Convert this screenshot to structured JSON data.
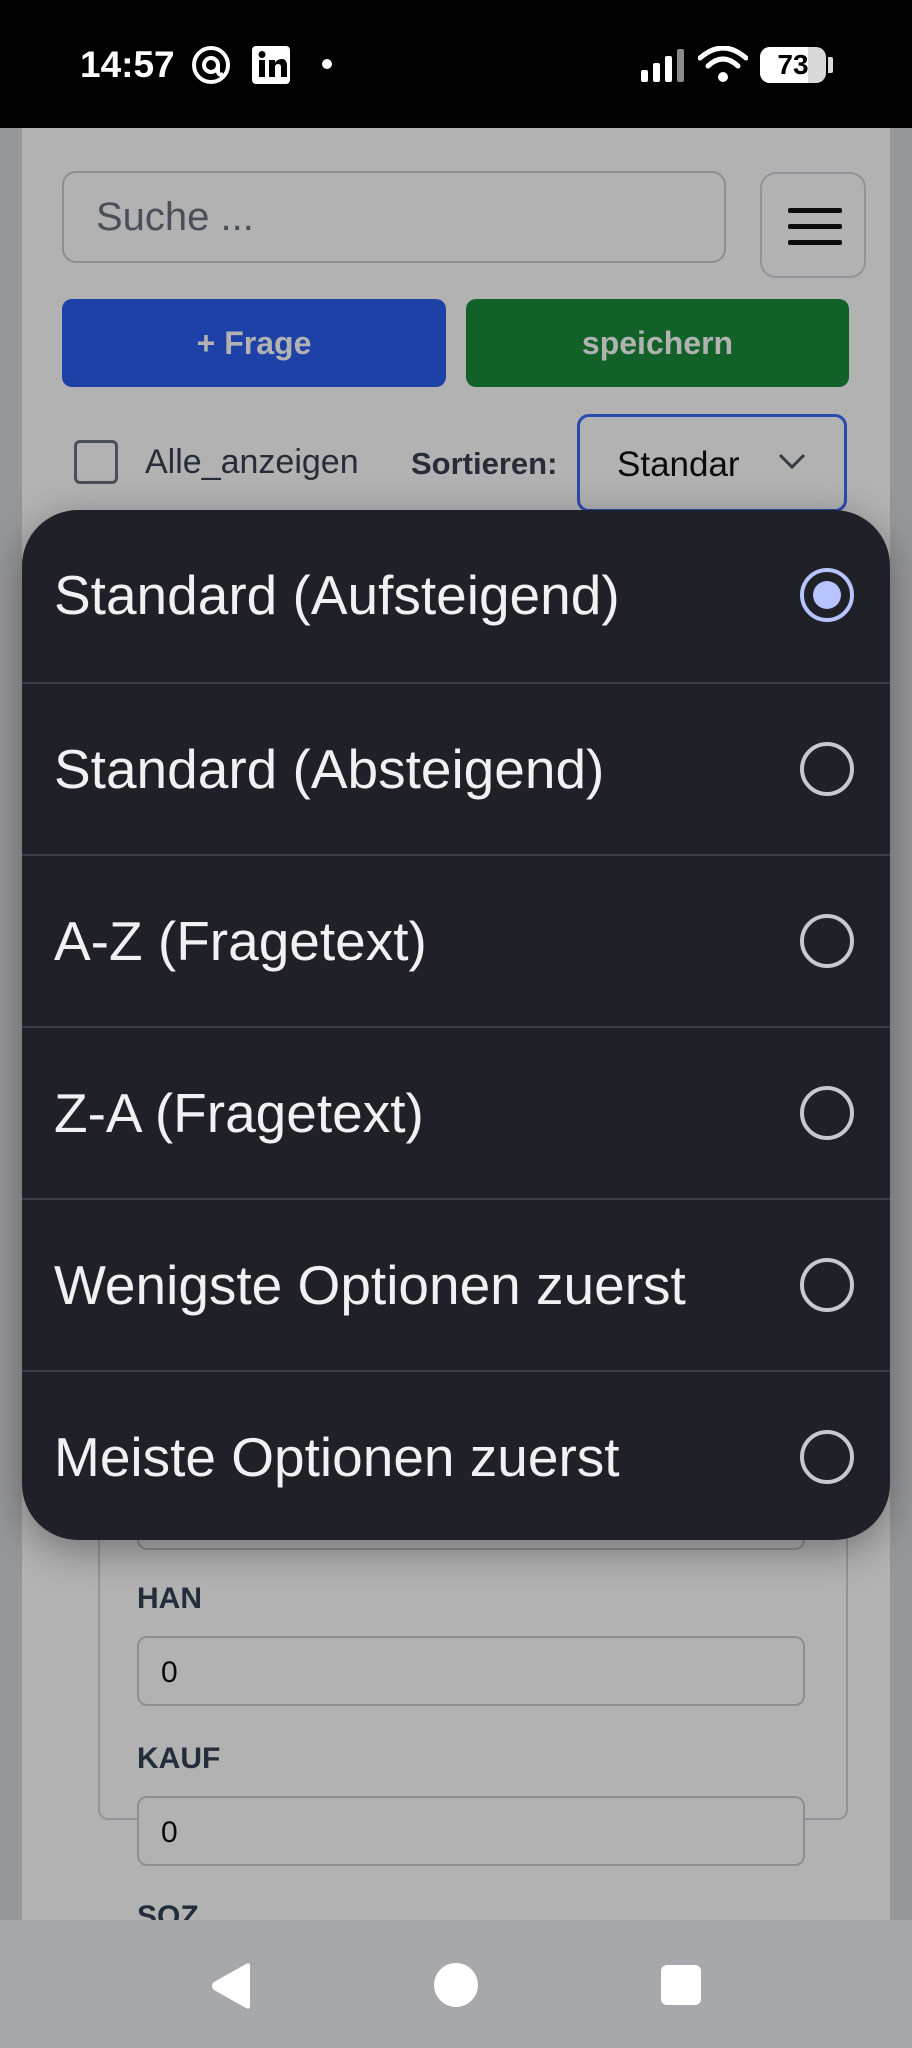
{
  "status_bar": {
    "time": "14:57",
    "battery": "73",
    "icons": [
      "threads-icon",
      "linkedin-icon",
      "notification-dot-icon",
      "signal-icon",
      "wifi-icon",
      "battery-icon"
    ]
  },
  "toolbar": {
    "search_placeholder": "Suche ...",
    "add_question_label": "+ Frage",
    "save_label": "speichern",
    "show_all_label": "Alle_anzeigen",
    "sort_label": "Sortieren:",
    "sort_selected": "Standar",
    "colors": {
      "add": "#2a5eef",
      "save": "#198c3a",
      "select_border": "#3d6cf5"
    }
  },
  "fields": [
    {
      "label": "",
      "value": ""
    },
    {
      "label": "HAN",
      "value": "0"
    },
    {
      "label": "KAUF",
      "value": "0"
    },
    {
      "label": "SOZ",
      "value": ""
    }
  ],
  "sort_sheet": {
    "options": [
      {
        "label": "Standard (Aufsteigend)",
        "selected": true
      },
      {
        "label": "Standard (Absteigend)",
        "selected": false
      },
      {
        "label": "A-Z (Fragetext)",
        "selected": false
      },
      {
        "label": "Z-A (Fragetext)",
        "selected": false
      },
      {
        "label": "Wenigste Optionen zuerst",
        "selected": false
      },
      {
        "label": "Meiste Optionen zuerst",
        "selected": false
      }
    ],
    "colors": {
      "background": "#1f2028",
      "accent": "#b7c4ff"
    }
  },
  "nav_bar": {
    "icons": [
      "back-icon",
      "home-icon",
      "recents-icon"
    ]
  }
}
